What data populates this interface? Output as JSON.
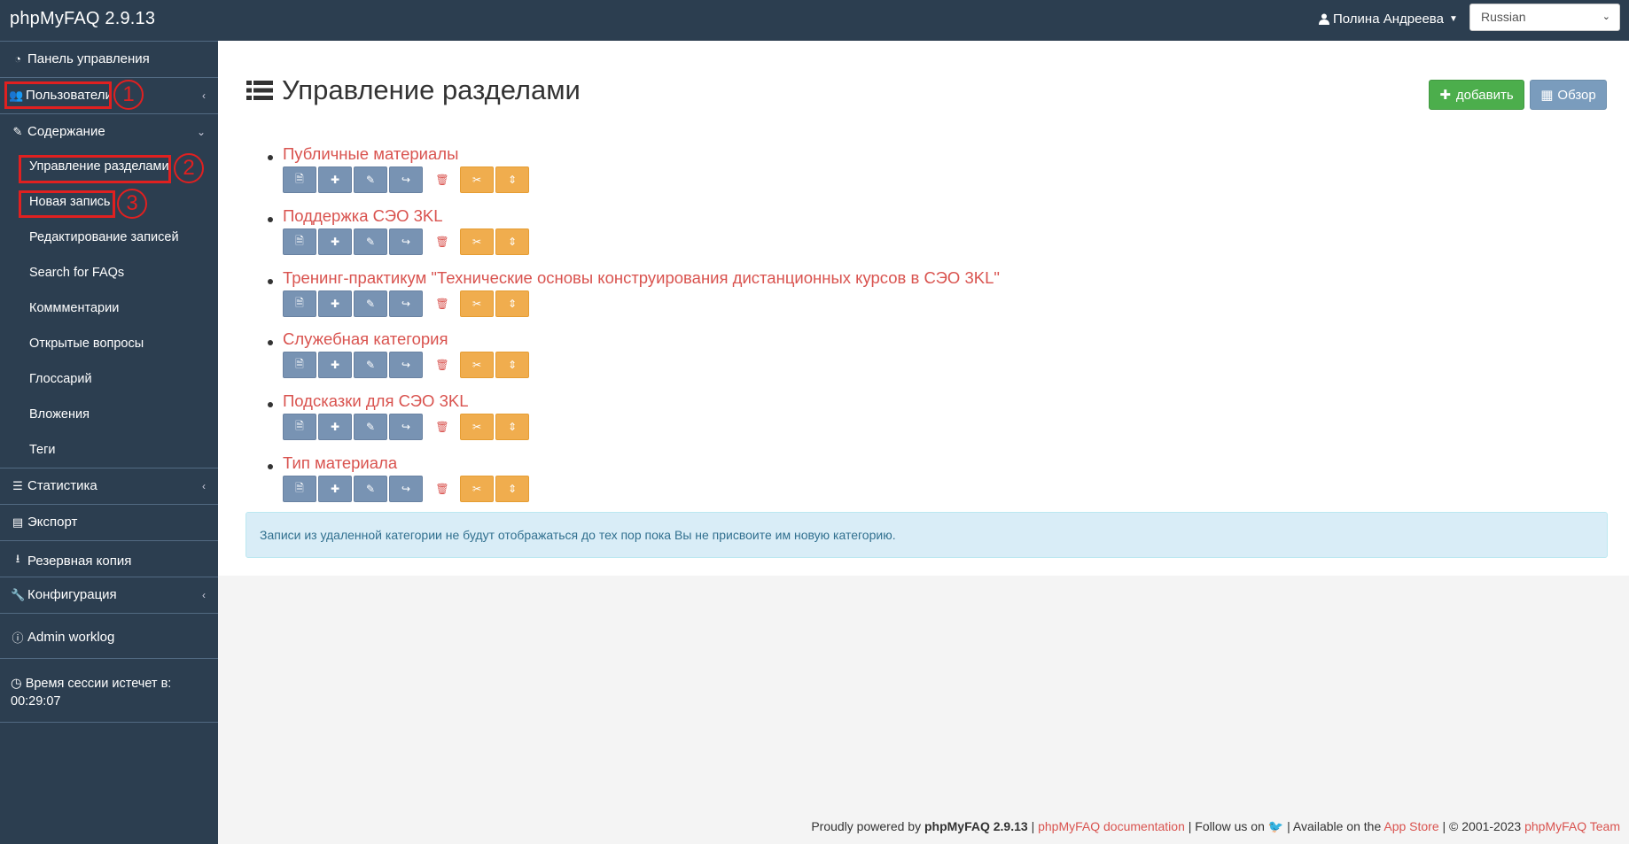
{
  "app": {
    "title": "phpMyFAQ 2.9.13"
  },
  "header": {
    "user_name": "Полина Андреева",
    "language": "Russian"
  },
  "sidebar": {
    "items": [
      {
        "label": "Панель управления"
      },
      {
        "label": "Пользователи"
      },
      {
        "label": "Содержание"
      },
      {
        "label": "Статистика"
      },
      {
        "label": "Экспорт"
      },
      {
        "label": "Резервная копия"
      },
      {
        "label": "Конфигурация"
      },
      {
        "label": "Admin worklog"
      }
    ],
    "content_sub": [
      {
        "label": "Управление разделами"
      },
      {
        "label": "Новая запись"
      },
      {
        "label": "Редактирование записей"
      },
      {
        "label": "Search for FAQs"
      },
      {
        "label": "Коммментарии"
      },
      {
        "label": "Открытые вопросы"
      },
      {
        "label": "Глоссарий"
      },
      {
        "label": "Вложения"
      },
      {
        "label": "Теги"
      }
    ],
    "session_label": "Время сессии истечет в:",
    "session_time": "00:29:07"
  },
  "annotations": {
    "n1": "1",
    "n2": "2",
    "n3": "3"
  },
  "main": {
    "title": "Управление разделами",
    "add_label": "добавить",
    "overview_label": "Обзор",
    "categories": [
      {
        "name": "Публичные материалы"
      },
      {
        "name": "Поддержка СЭО 3KL"
      },
      {
        "name": "Тренинг-практикум \"Технические основы конструирования дистанционных курсов в СЭО 3KL\""
      },
      {
        "name": "Служебная категория"
      },
      {
        "name": "Подсказки для СЭО 3KL"
      },
      {
        "name": "Тип материала"
      }
    ],
    "alert": "Записи из удаленной категории не будут отображаться до тех пор пока Вы не присвоите им новую категорию."
  },
  "footer": {
    "powered": "Proudly powered by",
    "product": "phpMyFAQ 2.9.13",
    "sep1": "|",
    "docs": "phpMyFAQ documentation",
    "follow": "| Follow us on",
    "sep2": "|",
    "available": "Available on the",
    "appstore": "App Store",
    "copyright": "| © 2001-2023",
    "team": "phpMyFAQ Team"
  },
  "colors": {
    "navbar": "#2c3e50",
    "link": "#d9534f",
    "success": "#4cae4c",
    "action_blue": "#7893b3",
    "action_orange": "#f0ad4e",
    "annotation": "#e02020"
  }
}
